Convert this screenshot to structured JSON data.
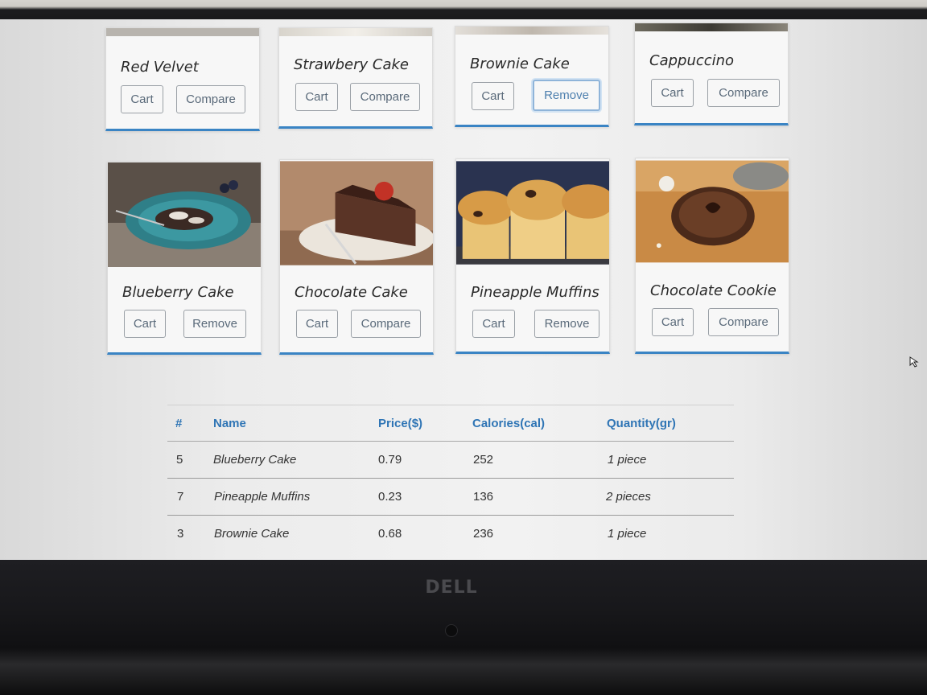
{
  "row1": [
    {
      "title": "Red Velvet",
      "cart": "Cart",
      "action": "Compare"
    },
    {
      "title": "Strawbery Cake",
      "cart": "Cart",
      "action": "Compare"
    },
    {
      "title": "Brownie Cake",
      "cart": "Cart",
      "action": "Remove"
    },
    {
      "title": "Cappuccino",
      "cart": "Cart",
      "action": "Compare"
    }
  ],
  "row2": [
    {
      "title": "Blueberry Cake",
      "cart": "Cart",
      "action": "Remove"
    },
    {
      "title": "Chocolate Cake",
      "cart": "Cart",
      "action": "Compare"
    },
    {
      "title": "Pineapple Muffins",
      "cart": "Cart",
      "action": "Remove"
    },
    {
      "title": "Chocolate Cookie",
      "cart": "Cart",
      "action": "Compare"
    }
  ],
  "table": {
    "headers": [
      "#",
      "Name",
      "Price($)",
      "Calories(cal)",
      "Quantity(gr)"
    ],
    "rows": [
      [
        "5",
        "Blueberry Cake",
        "0.79",
        "252",
        "1 piece"
      ],
      [
        "7",
        "Pineapple Muffins",
        "0.23",
        "136",
        "2 pieces"
      ],
      [
        "3",
        "Brownie Cake",
        "0.68",
        "236",
        "1 piece"
      ]
    ]
  },
  "brand": "DELL",
  "colors": {
    "accent": "#3a84c4",
    "header_text": "#2f75b5"
  }
}
